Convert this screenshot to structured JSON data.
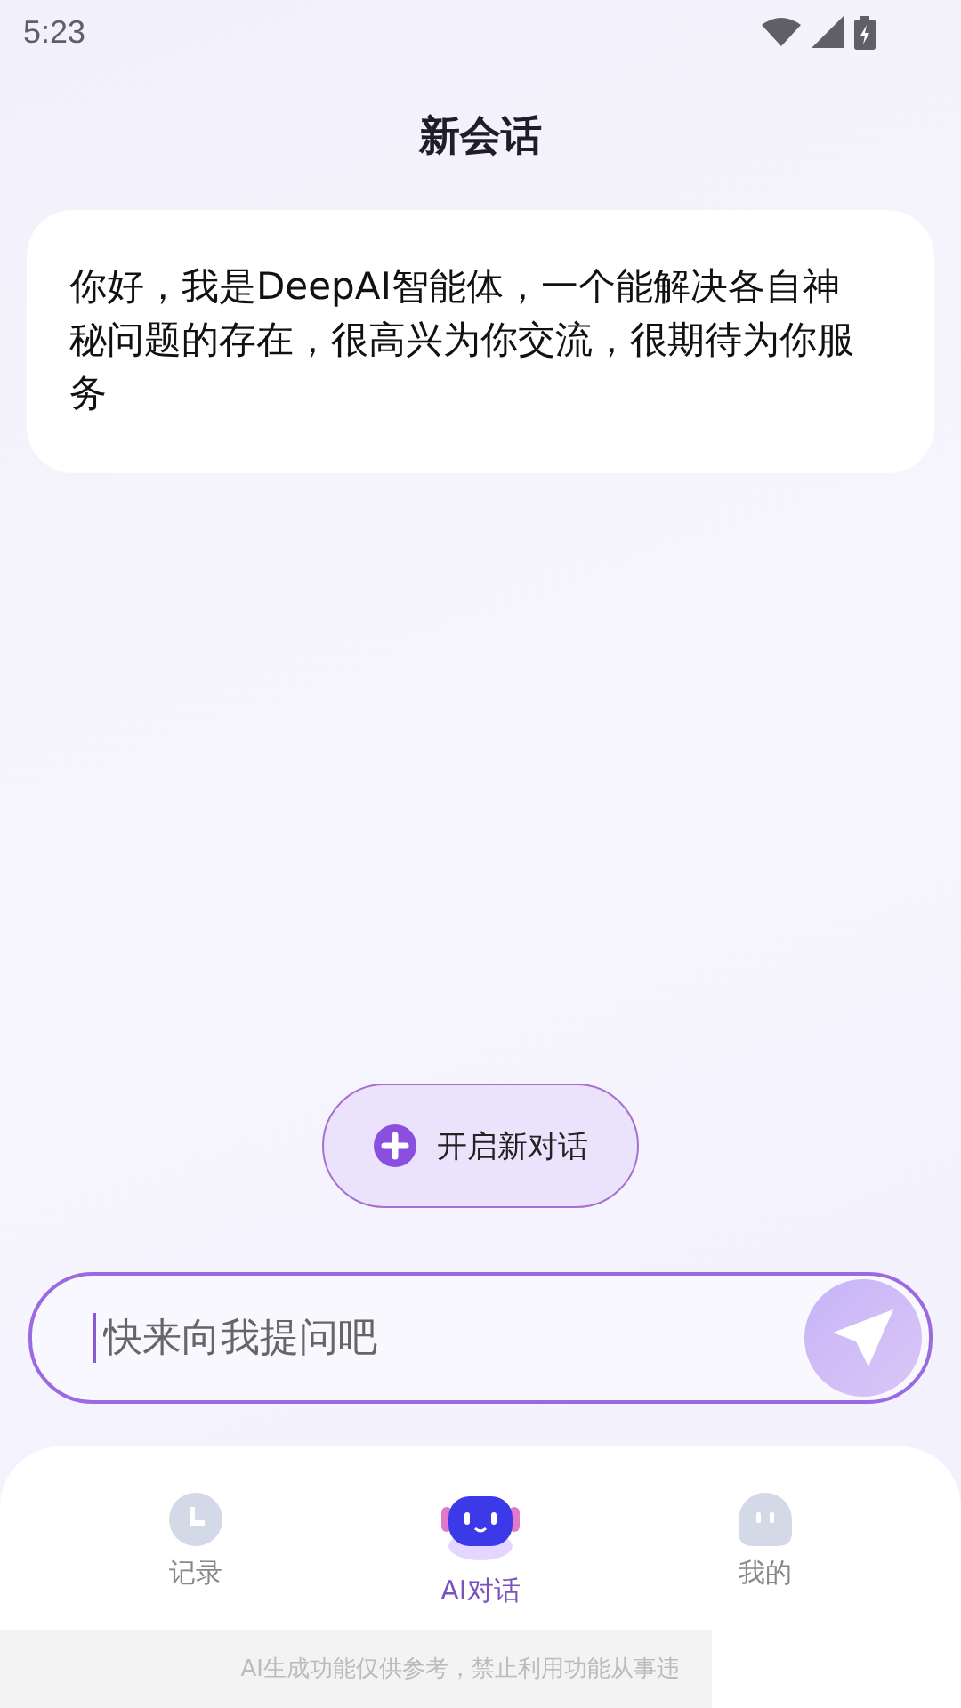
{
  "status_bar": {
    "time": "5:23"
  },
  "header": {
    "title": "新会话"
  },
  "messages": [
    {
      "text": "你好，我是DeepAI智能体，一个能解决各自神秘问题的存在，很高兴为你交流，很期待为你服务"
    }
  ],
  "new_chat_button": {
    "label": "开启新对话"
  },
  "input": {
    "placeholder": "快来向我提问吧"
  },
  "tabs": [
    {
      "label": "记录",
      "kind": "history",
      "selected": false
    },
    {
      "label": "AI对话",
      "kind": "robot",
      "selected": true
    },
    {
      "label": "我的",
      "kind": "profile",
      "selected": false
    }
  ],
  "disclaimer": "AI生成功能仅供参考，禁止利用功能从事违"
}
